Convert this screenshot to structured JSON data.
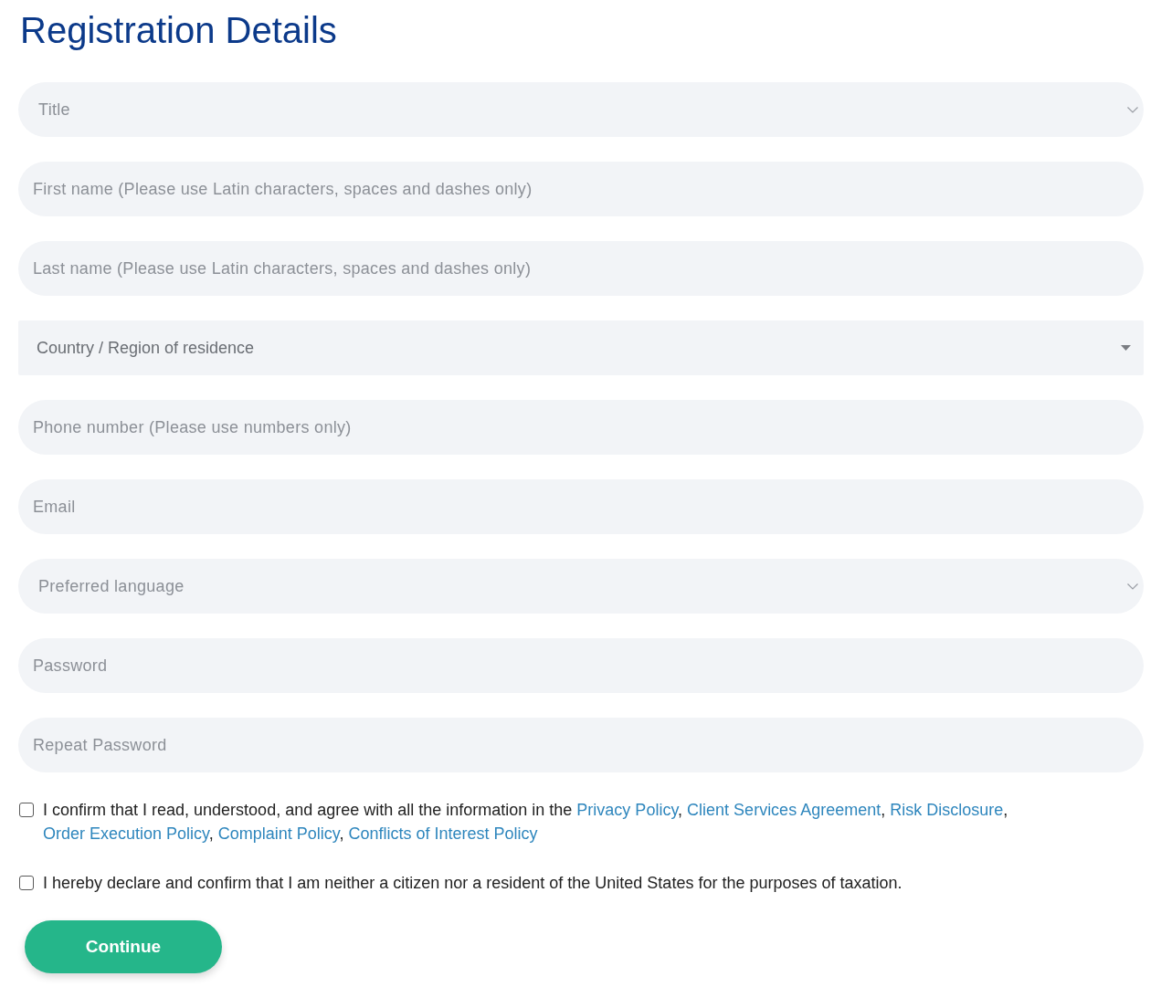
{
  "heading": "Registration Details",
  "fields": [
    {
      "kind": "dropdown",
      "placeholder": "Title"
    },
    {
      "kind": "input",
      "placeholder": "First name (Please use Latin characters, spaces and dashes only)"
    },
    {
      "kind": "input",
      "placeholder": "Last name (Please use Latin characters, spaces and dashes only)"
    },
    {
      "kind": "native-select",
      "placeholder": "Country / Region of residence"
    },
    {
      "kind": "input",
      "placeholder": "Phone number (Please use numbers only)"
    },
    {
      "kind": "input",
      "placeholder": "Email"
    },
    {
      "kind": "dropdown",
      "placeholder": "Preferred language"
    },
    {
      "kind": "input",
      "placeholder": "Password"
    },
    {
      "kind": "input",
      "placeholder": "Repeat Password"
    }
  ],
  "agreements": [
    {
      "checked": false,
      "text": "I confirm that I read, understood, and agree with all the information in the",
      "links": [
        "Privacy Policy",
        "Client Services Agreement",
        "Risk Disclosure",
        "Order Execution Policy",
        "Complaint Policy",
        "Conflicts of Interest Policy"
      ],
      "link_separator": ","
    },
    {
      "checked": false,
      "text": "I hereby declare and confirm that I am neither a citizen nor a resident of the United States for the purposes of taxation."
    }
  ],
  "button": "Continue"
}
